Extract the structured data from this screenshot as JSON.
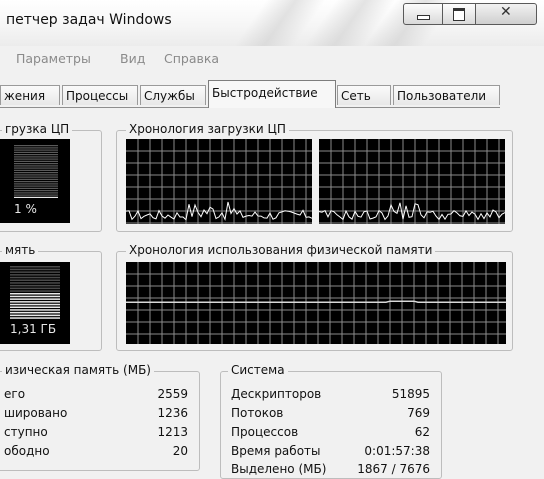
{
  "window": {
    "title": "петчер задач Windows"
  },
  "menu": [
    "Параметры",
    "Вид",
    "Справка"
  ],
  "tabs": [
    {
      "label": "жения",
      "active": false
    },
    {
      "label": "Процессы",
      "active": false
    },
    {
      "label": "Службы",
      "active": false
    },
    {
      "label": "Быстродействие",
      "active": true
    },
    {
      "label": "Сеть",
      "active": false
    },
    {
      "label": "Пользователи",
      "active": false
    }
  ],
  "cpu_usage": {
    "label": "грузка ЦП",
    "value": "1 %",
    "percent": 1
  },
  "cpu_history": {
    "label": "Хронология загрузки ЦП"
  },
  "memory": {
    "label": "мять",
    "value": "1,31 ГБ",
    "fraction": 0.51
  },
  "memory_history": {
    "label": "Хронология использования физической памяти"
  },
  "physical_memory": {
    "label": "изическая память (МБ)",
    "rows": [
      {
        "label": "его",
        "value": "2559"
      },
      {
        "label": "шировано",
        "value": "1236"
      },
      {
        "label": "ступно",
        "value": "1213"
      },
      {
        "label": "ободно",
        "value": "20"
      }
    ]
  },
  "system": {
    "label": "Система",
    "rows": [
      {
        "label": "Дескрипторов",
        "value": "51895"
      },
      {
        "label": "Потоков",
        "value": "769"
      },
      {
        "label": "Процессов",
        "value": "62"
      },
      {
        "label": "Время работы",
        "value": "0:01:57:38"
      },
      {
        "label": "Выделено (МБ)",
        "value": "1867 / 7676"
      }
    ]
  },
  "colors": {
    "grid": "#8a8a8a",
    "trace": "#ffffff",
    "panel": "#000000"
  }
}
